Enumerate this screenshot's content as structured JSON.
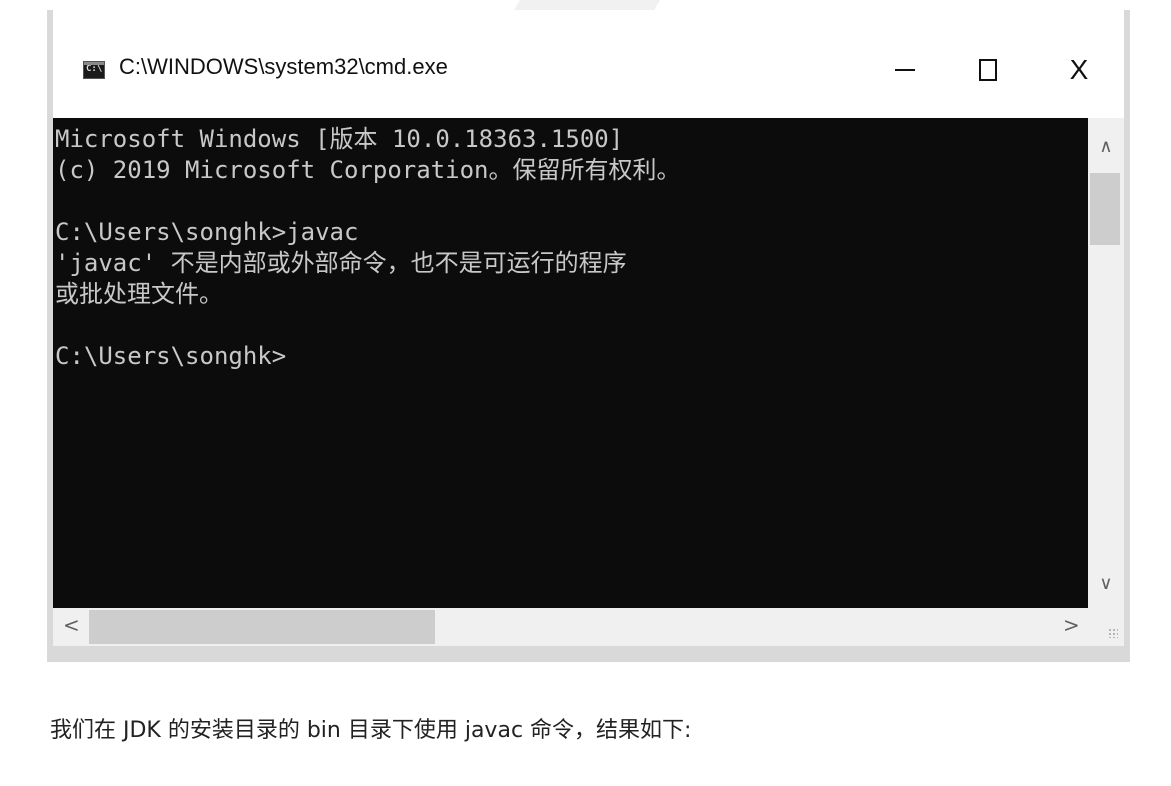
{
  "window": {
    "title": "C:\\WINDOWS\\system32\\cmd.exe",
    "minimize_icon": "minimize-icon",
    "maximize_icon": "maximize-icon",
    "close_label": "X"
  },
  "console": {
    "text": "Microsoft Windows [版本 10.0.18363.1500]\n(c) 2019 Microsoft Corporation。保留所有权利。\n\nC:\\Users\\songhk>javac\n'javac' 不是内部或外部命令，也不是可运行的程序\n或批处理文件。\n\nC:\\Users\\songhk>"
  },
  "scrollbars": {
    "up_arrow": "∧",
    "down_arrow": "∨",
    "left_arrow": "<",
    "right_arrow": ">"
  },
  "caption": "我们在 JDK 的安装目录的 bin 目录下使用 javac 命令，结果如下:",
  "colors": {
    "console_bg": "#0c0c0c",
    "console_fg": "#c8c8c8",
    "frame": "#d9d9d9"
  }
}
